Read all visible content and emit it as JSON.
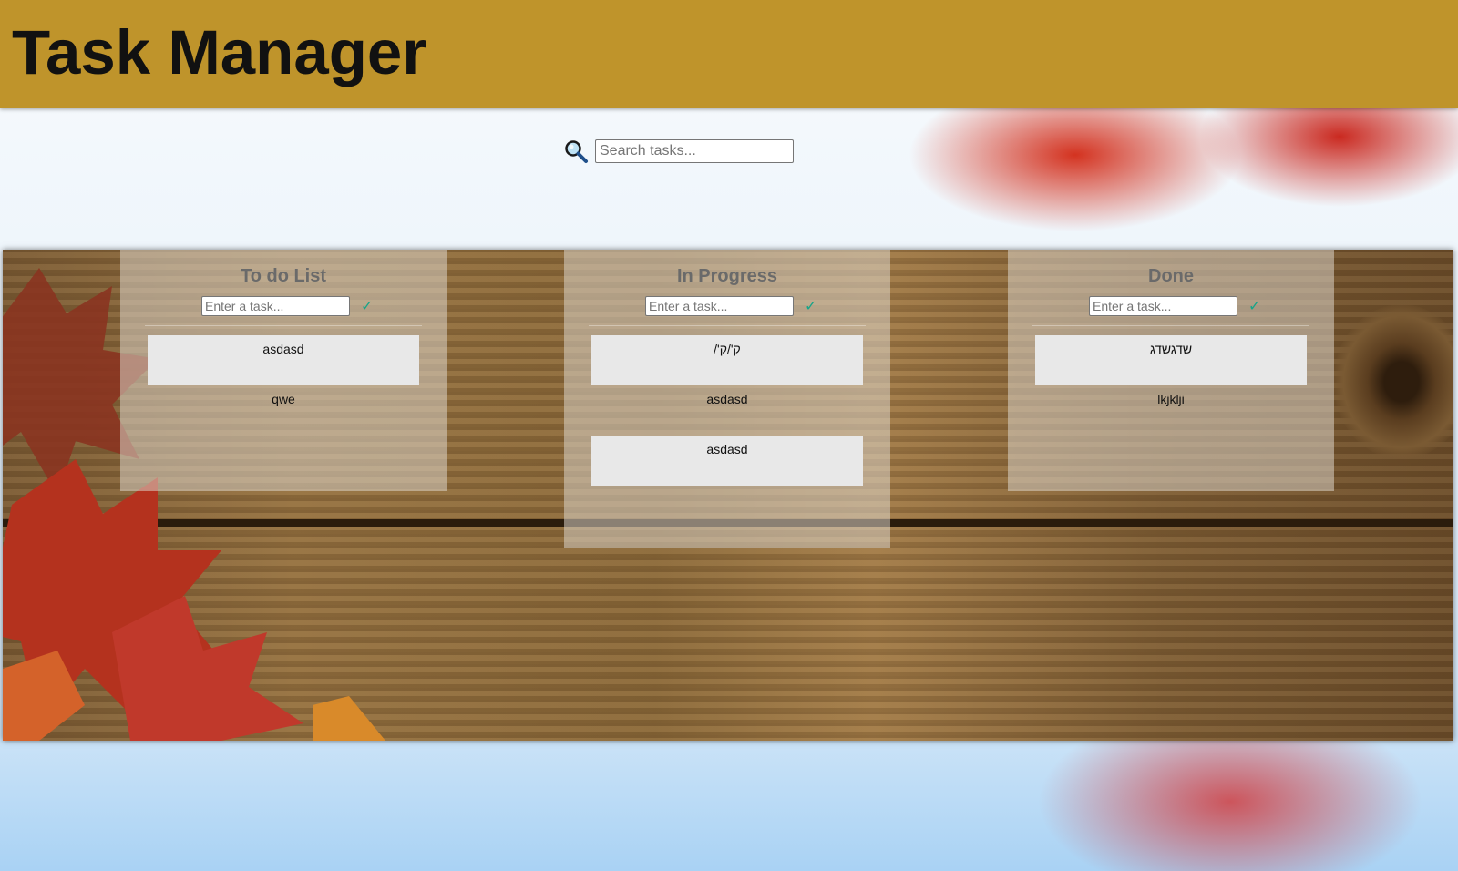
{
  "header": {
    "title": "Task Manager"
  },
  "search": {
    "placeholder": "Search tasks..."
  },
  "columns": [
    {
      "title": "To do List",
      "input_placeholder": "Enter a task...",
      "add_label": "✓",
      "tasks": [
        "asdasd",
        "qwe"
      ]
    },
    {
      "title": "In Progress",
      "input_placeholder": "Enter a task...",
      "add_label": "✓",
      "tasks": [
        "ק'/ק'/",
        "asdasd",
        "asdasd"
      ]
    },
    {
      "title": "Done",
      "input_placeholder": "Enter a task...",
      "add_label": "✓",
      "tasks": [
        "שדגשדג",
        "lkjklji"
      ]
    }
  ],
  "colors": {
    "header": "#bf942b",
    "accent": "#17a589"
  }
}
